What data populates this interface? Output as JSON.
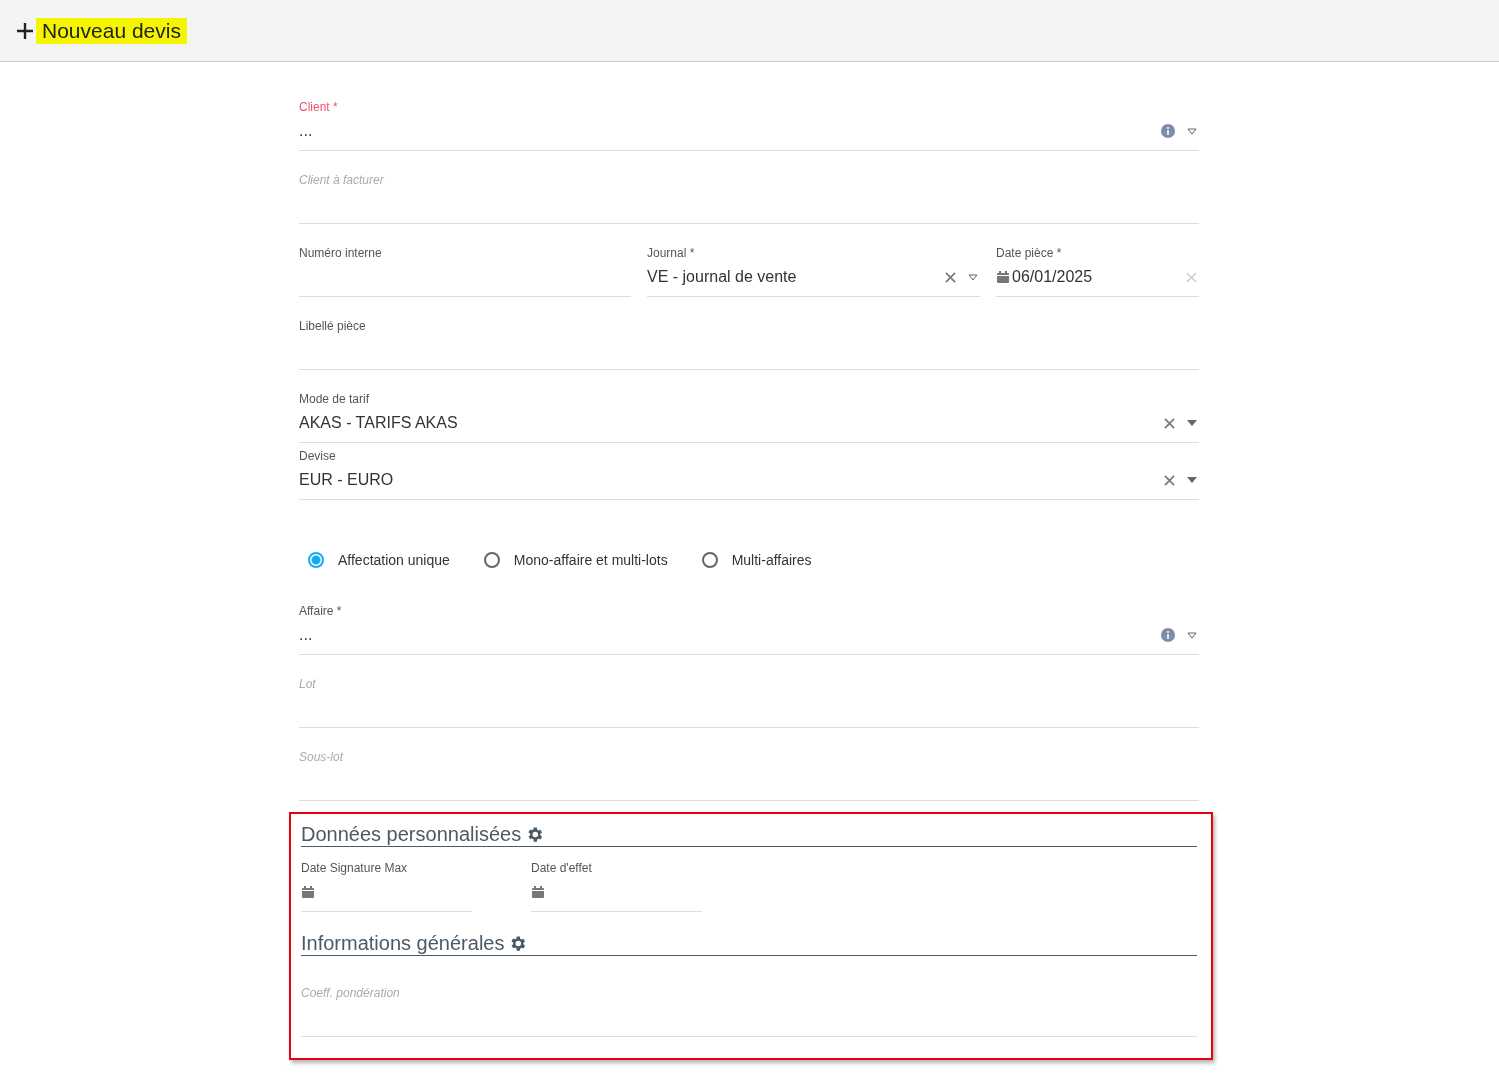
{
  "header": {
    "title": "Nouveau devis",
    "highlighted": true
  },
  "rows": [
    {
      "fields": [
        {
          "kind": "lookup",
          "label": "Client *",
          "value": "...",
          "error": true
        }
      ]
    },
    {
      "fields": [
        {
          "kind": "placeholder",
          "label": "Client à facturer",
          "error": false
        }
      ]
    },
    {
      "fields": [
        {
          "kind": "text",
          "label": "Numéro interne",
          "error": false
        },
        {
          "kind": "select-outline",
          "label": "Journal *",
          "value": "VE - journal de vente",
          "error": false
        },
        {
          "kind": "date-clear",
          "label": "Date pièce *",
          "value": "06/01/2025",
          "error": false
        }
      ]
    },
    {
      "fields": [
        {
          "kind": "text",
          "label": "Libellé pièce",
          "error": false
        }
      ]
    },
    {
      "fields": [
        {
          "kind": "select",
          "label": "Mode de tarif",
          "value": "AKAS - TARIFS AKAS",
          "error": false
        }
      ]
    },
    {
      "fields": [
        {
          "kind": "select",
          "label": "Devise",
          "value": "EUR - EURO",
          "error": false
        }
      ]
    }
  ],
  "assignment": [
    {
      "label": "Affectation unique",
      "selected": true
    },
    {
      "label": "Mono-affaire et multi-lots",
      "selected": false
    },
    {
      "label": "Multi-affaires",
      "selected": false
    }
  ],
  "rows2": [
    {
      "fields": [
        {
          "kind": "lookup",
          "label": "Affaire *",
          "value": "...",
          "error": false
        }
      ]
    },
    {
      "fields": [
        {
          "kind": "placeholder",
          "label": "Lot",
          "error": false
        }
      ]
    },
    {
      "fields": [
        {
          "kind": "placeholder",
          "label": "Sous-lot",
          "error": false
        }
      ]
    }
  ],
  "highlight_box": {
    "highlighted": true,
    "sections": [
      {
        "title": "Données personnalisées",
        "fields": [
          {
            "kind": "date",
            "label": "Date Signature Max",
            "error": false
          },
          {
            "kind": "date",
            "label": "Date d'effet",
            "error": false
          }
        ]
      },
      {
        "title": "Informations générales",
        "fields": [
          {
            "kind": "placeholder",
            "label": "Coeff. pondération",
            "error": false
          }
        ]
      }
    ]
  }
}
